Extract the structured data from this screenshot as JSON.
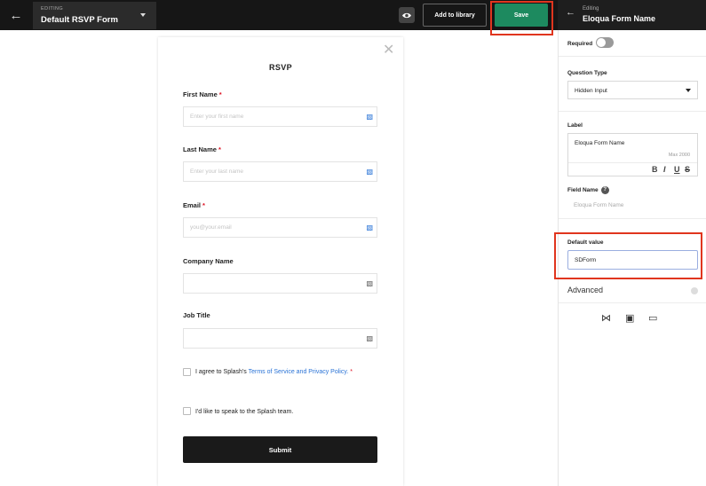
{
  "topbar": {
    "back_icon": "arrow-left-icon",
    "editing_label": "EDITING",
    "form_name": "Default RSVP Form",
    "preview_icon": "eye-icon",
    "add_to_library_label": "Add to library",
    "save_label": "Save"
  },
  "panel_header": {
    "back_icon": "arrow-left-icon",
    "editing_label": "Editing",
    "field_name": "Eloqua Form Name"
  },
  "form": {
    "title": "RSVP",
    "fields": [
      {
        "label": "First Name",
        "required_mark": "*",
        "placeholder": "Enter your first name"
      },
      {
        "label": "Last Name",
        "required_mark": "*",
        "placeholder": "Enter your last name"
      },
      {
        "label": "Email",
        "required_mark": "*",
        "placeholder": "you@your.email"
      },
      {
        "label": "Company Name",
        "required_mark": "",
        "placeholder": ""
      },
      {
        "label": "Job Title",
        "required_mark": "",
        "placeholder": ""
      }
    ],
    "terms": {
      "prefix": "I agree to Splash's ",
      "link": "Terms of Service and Privacy Policy.",
      "required_mark": "*"
    },
    "speak_label": "I'd like to speak to the Splash team.",
    "submit_label": "Submit"
  },
  "panel": {
    "required_label": "Required",
    "question_type_label": "Question Type",
    "question_type_value": "Hidden Input",
    "label_heading": "Label",
    "label_value": "Eloqua Form Name",
    "label_max": "Max 2000",
    "format_buttons": [
      "B",
      "I",
      "U",
      "S"
    ],
    "field_name_label": "Field Name",
    "field_name_placeholder": "Eloqua Form Name",
    "default_value_label": "Default value",
    "default_value": "SDForm",
    "advanced_label": "Advanced",
    "action_icons": [
      "branch-icon",
      "bookmark-add-icon",
      "trash-icon"
    ]
  },
  "colors": {
    "topbar_bg": "#161616",
    "save_green": "#1d8a5f",
    "highlight_red": "#e0351e",
    "link_blue": "#2a73d6",
    "required_red": "#d12222"
  }
}
